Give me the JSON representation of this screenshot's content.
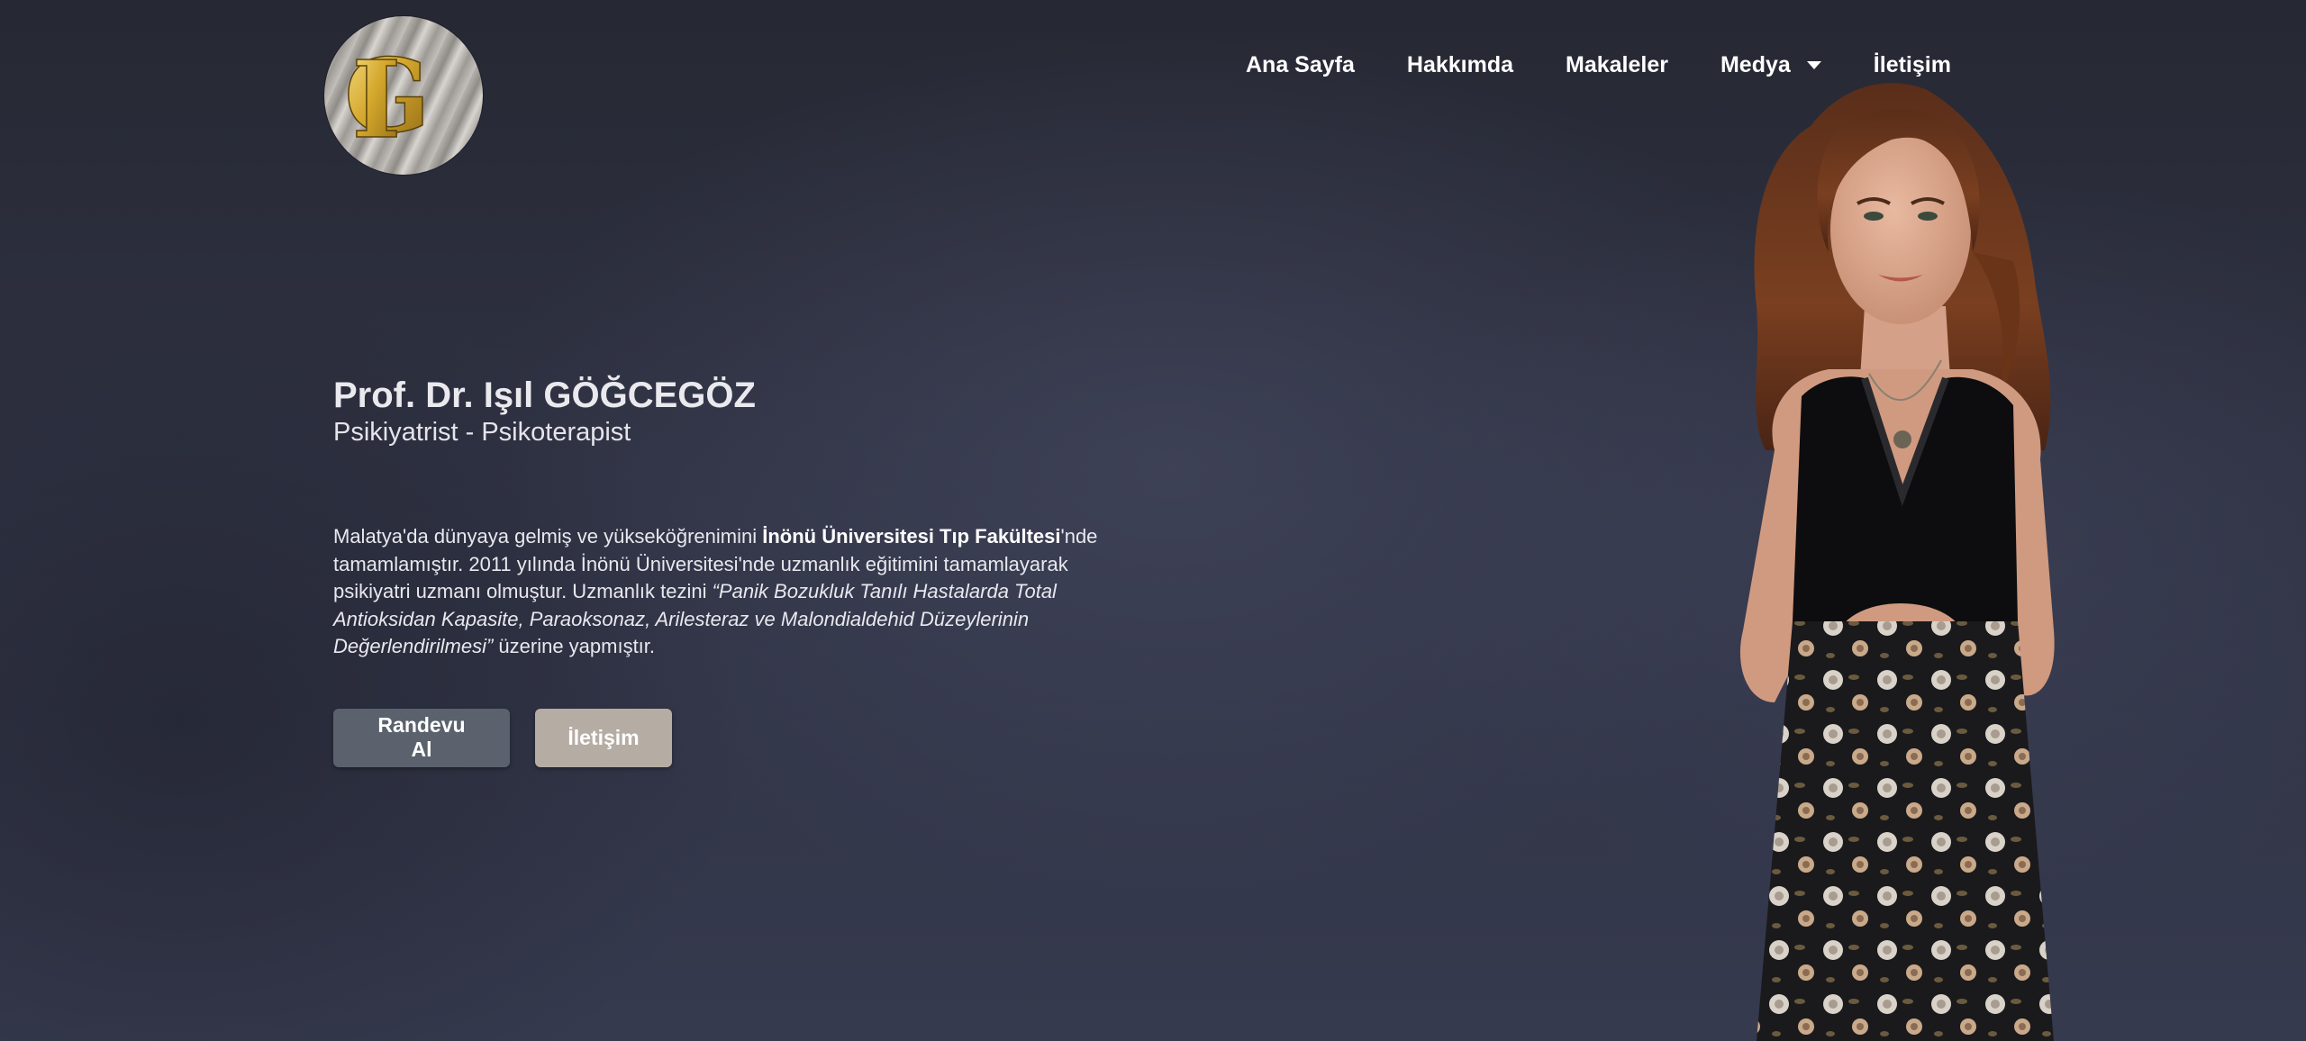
{
  "logo": {
    "monogram": "IG",
    "icon": "ig-monogram-logo"
  },
  "nav": {
    "items": [
      {
        "label": "Ana Sayfa"
      },
      {
        "label": "Hakkımda"
      },
      {
        "label": "Makaleler"
      },
      {
        "label": "Medya",
        "has_dropdown": true
      },
      {
        "label": "İletişim"
      }
    ]
  },
  "hero": {
    "name": "Prof. Dr. Işıl GÖĞCEGÖZ",
    "title": "Psikiyatrist - Psikoterapist",
    "bio": {
      "p1": "Malatya'da dünyaya gelmiş ve yükseköğrenimini ",
      "b1": "İnönü Üniversitesi Tıp Fakültesi",
      "p2": "'nde tamamlamıştır. 2011 yılında İnönü Üniversitesi'nde uzmanlık eğitimini tamamlayarak psikiyatri uzmanı olmuştur. Uzmanlık tezini ",
      "i1": "“Panik Bozukluk Tanılı Hastalarda Total Antioksidan Kapasite, Paraoksonaz, Arilesteraz ve Malondialdehid Düzeylerinin Değerlendirilmesi”",
      "p3": " üzerine yapmıştır."
    },
    "buttons": {
      "primary": "Randevu Al",
      "secondary": "İletişim"
    }
  },
  "colors": {
    "background": "#2f3243",
    "button_primary": "#5b626d",
    "button_secondary": "#b5aca4",
    "text": "#ffffff"
  }
}
